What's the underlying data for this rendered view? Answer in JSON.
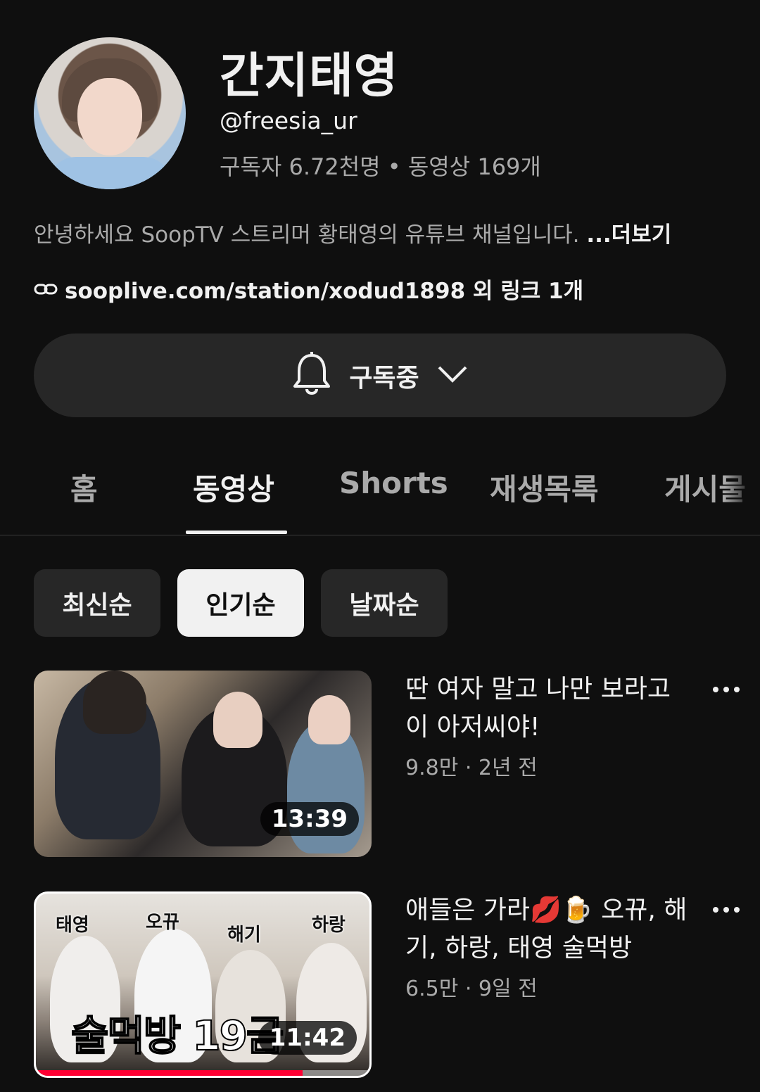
{
  "channel": {
    "name": "간지태영",
    "handle": "@freesia_ur",
    "stats": "구독자 6.72천명 • 동영상 169개",
    "description": "안녕하세요 SoopTV 스트리머 황태영의 유튜브 채널입니다. ",
    "more_label": "...더보기",
    "link_text": "sooplive.com/station/xodud1898 외 링크 1개",
    "link_icon": "link-icon"
  },
  "subscribe": {
    "label": "구독중",
    "icon": "bell-icon"
  },
  "tabs": [
    {
      "label": "홈"
    },
    {
      "label": "동영상"
    },
    {
      "label": "Shorts"
    },
    {
      "label": "재생목록"
    },
    {
      "label": "게시물"
    }
  ],
  "active_tab": "동영상",
  "chips": [
    {
      "label": "최신순"
    },
    {
      "label": "인기순"
    },
    {
      "label": "날짜순"
    }
  ],
  "active_chip": "인기순",
  "videos": [
    {
      "title": "딴 여자 말고 나만 보라고 이 아저씨야!",
      "meta": "9.8만 · 2년 전",
      "duration": "13:39"
    },
    {
      "title": "애들은 가라💋🍺 오뀨, 해기, 하랑, 태영 술먹방",
      "meta": "6.5만 · 9일 전",
      "duration": "11:42",
      "thumb_labels": [
        "태영",
        "오뀨",
        "해기",
        "하랑"
      ],
      "thumb_caption": "술먹방 19금",
      "watch_progress": 0.8
    }
  ],
  "colors": {
    "background": "#0f0f0f",
    "secondary_text": "#aaaaaa",
    "chip_bg": "#272727",
    "progress": "#ff0033"
  }
}
